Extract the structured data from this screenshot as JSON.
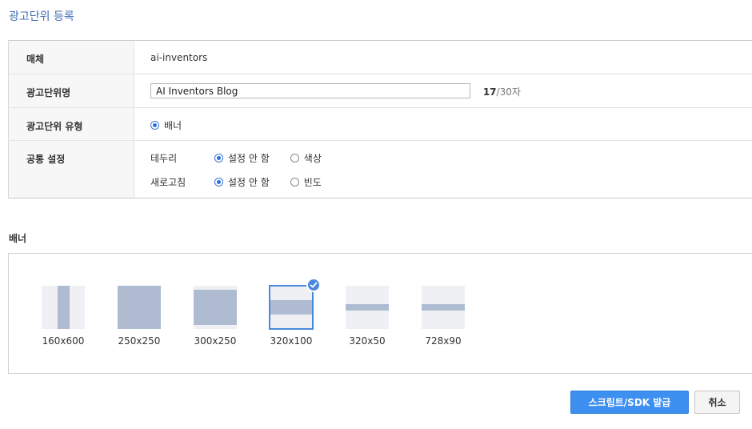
{
  "page": {
    "title": "광고단위 등록"
  },
  "form": {
    "media": {
      "label": "매체",
      "value": "ai-inventors"
    },
    "ad_unit_name": {
      "label": "광고단위명",
      "value": "AI Inventors Blog",
      "count_current": "17",
      "count_max": "/30자"
    },
    "ad_unit_type": {
      "label": "광고단위 유형",
      "option": "배너",
      "selected": true
    },
    "common": {
      "label": "공통 설정",
      "border": {
        "label": "테두리",
        "options": [
          "설정 안 함",
          "색상"
        ],
        "selected_index": 0
      },
      "refresh": {
        "label": "새로고침",
        "options": [
          "설정 안 함",
          "빈도"
        ],
        "selected_index": 0
      }
    }
  },
  "banner": {
    "section_title": "배너",
    "sizes": [
      {
        "label": "160x600",
        "shape": "vertical-bar",
        "selected": false
      },
      {
        "label": "250x250",
        "shape": "full",
        "selected": false
      },
      {
        "label": "300x250",
        "shape": "rect",
        "selected": false
      },
      {
        "label": "320x100",
        "shape": "band",
        "selected": true
      },
      {
        "label": "320x50",
        "shape": "thin-band",
        "selected": false
      },
      {
        "label": "728x90",
        "shape": "thin-band",
        "selected": false
      }
    ]
  },
  "actions": {
    "issue_label": "스크립트/SDK 발급",
    "cancel_label": "취소"
  },
  "colors": {
    "accent": "#3d8ff0",
    "title": "#3f6fb5",
    "thumb_bg": "#eef0f3",
    "thumb_fill": "#aebbd1"
  },
  "icons": {
    "selected_badge": "check-icon"
  }
}
